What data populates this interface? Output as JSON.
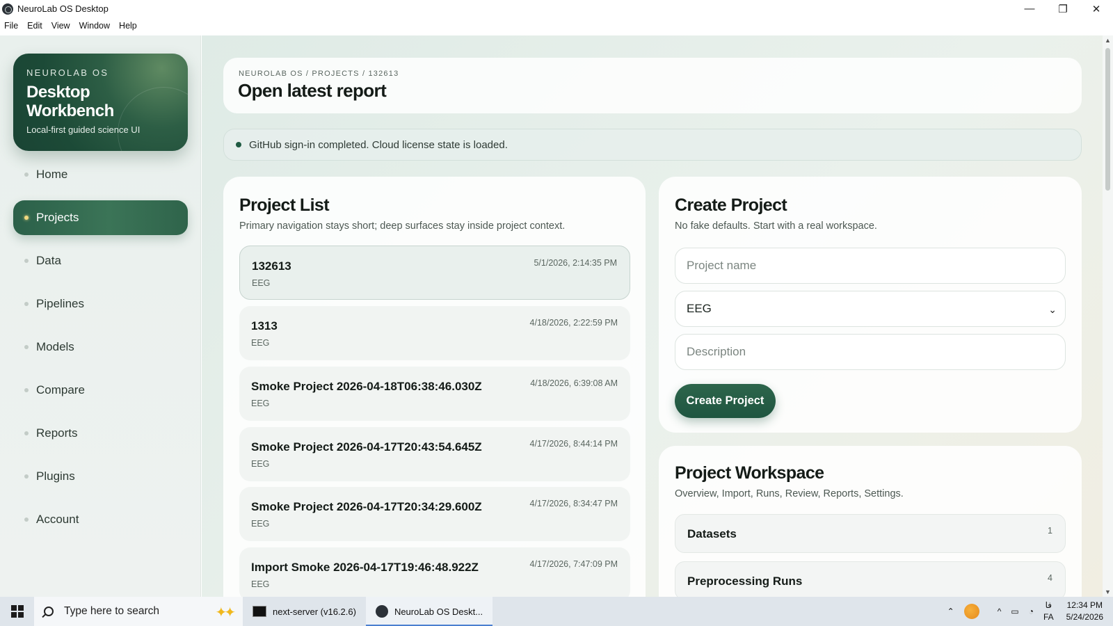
{
  "window": {
    "title": "NeuroLab OS Desktop",
    "controls": {
      "minimize": "—",
      "restore": "❐",
      "close": "✕"
    }
  },
  "menu": [
    "File",
    "Edit",
    "View",
    "Window",
    "Help"
  ],
  "brand": {
    "kicker": "NEUROLAB OS",
    "title": "Desktop Workbench",
    "subtitle": "Local-first guided science UI"
  },
  "nav": {
    "items": [
      {
        "label": "Home",
        "active": false
      },
      {
        "label": "Projects",
        "active": true
      },
      {
        "label": "Data",
        "active": false
      },
      {
        "label": "Pipelines",
        "active": false
      },
      {
        "label": "Models",
        "active": false
      },
      {
        "label": "Compare",
        "active": false
      },
      {
        "label": "Reports",
        "active": false
      },
      {
        "label": "Plugins",
        "active": false
      },
      {
        "label": "Account",
        "active": false
      }
    ]
  },
  "header": {
    "breadcrumb": "NEUROLAB OS / PROJECTS / 132613",
    "title": "Open latest report"
  },
  "status": {
    "message": "GitHub sign-in completed. Cloud license state is loaded."
  },
  "project_list": {
    "title": "Project List",
    "subtitle": "Primary navigation stays short; deep surfaces stay inside project context.",
    "projects": [
      {
        "name": "132613",
        "type": "EEG",
        "date": "5/1/2026, 2:14:35 PM",
        "selected": true
      },
      {
        "name": "1313",
        "type": "EEG",
        "date": "4/18/2026, 2:22:59 PM",
        "selected": false
      },
      {
        "name": "Smoke Project 2026-04-18T06:38:46.030Z",
        "type": "EEG",
        "date": "4/18/2026, 6:39:08 AM",
        "selected": false
      },
      {
        "name": "Smoke Project 2026-04-17T20:43:54.645Z",
        "type": "EEG",
        "date": "4/17/2026, 8:44:14 PM",
        "selected": false
      },
      {
        "name": "Smoke Project 2026-04-17T20:34:29.600Z",
        "type": "EEG",
        "date": "4/17/2026, 8:34:47 PM",
        "selected": false
      },
      {
        "name": "Import Smoke 2026-04-17T19:46:48.922Z",
        "type": "EEG",
        "date": "4/17/2026, 7:47:09 PM",
        "selected": false
      }
    ]
  },
  "create_project": {
    "title": "Create Project",
    "subtitle": "No fake defaults. Start with a real workspace.",
    "name_placeholder": "Project name",
    "modality_value": "EEG",
    "description_placeholder": "Description",
    "submit_label": "Create Project"
  },
  "workspace": {
    "title": "Project Workspace",
    "subtitle": "Overview, Import, Runs, Review, Reports, Settings.",
    "sections": [
      {
        "label": "Datasets",
        "count": "1"
      },
      {
        "label": "Preprocessing Runs",
        "count": "4"
      }
    ]
  },
  "taskbar": {
    "search_placeholder": "Type here to search",
    "apps": [
      {
        "label": "next-server (v16.2.6)"
      },
      {
        "label": "NeuroLab OS Deskt..."
      }
    ],
    "lang_top": "فا",
    "lang_bottom": "FA",
    "time": "12:34 PM",
    "date": "5/24/2026"
  },
  "colors": {
    "accent": "#2b6049",
    "brand_dark": "#1c4a37",
    "background": "#e6efea"
  }
}
